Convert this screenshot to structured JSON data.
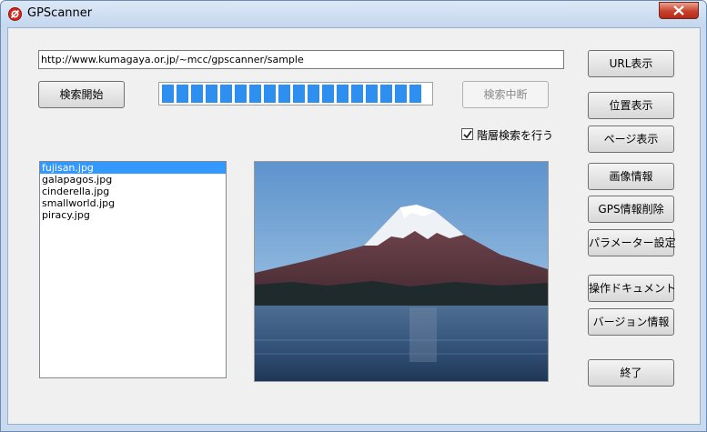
{
  "window": {
    "title": "GPScanner"
  },
  "url": {
    "value": "http://www.kumagaya.or.jp/~mcc/gpscanner/sample"
  },
  "controls": {
    "start_search": "検索開始",
    "stop_search": "検索中断",
    "hierarchical_label": "階層検索を行う",
    "hierarchical_checked": true
  },
  "progress": {
    "filled_segments": 18,
    "total_segments": 18
  },
  "files": {
    "items": [
      "fujisan.jpg",
      "galapagos.jpg",
      "cinderella.jpg",
      "smallworld.jpg",
      "piracy.jpg"
    ],
    "selected_index": 0
  },
  "side_buttons": {
    "url": "URL表示",
    "location": "位置表示",
    "page": "ページ表示",
    "image_info": "画像情報",
    "gps_delete": "GPS情報削除",
    "params": "パラメーター設定",
    "manual": "操作ドキュメント",
    "version": "バージョン情報",
    "exit": "終了"
  },
  "preview": {
    "subject": "mountain-lake-photo"
  },
  "colors": {
    "progress": "#2e8ff0",
    "selection": "#3399ff",
    "close": "#c8412c"
  }
}
